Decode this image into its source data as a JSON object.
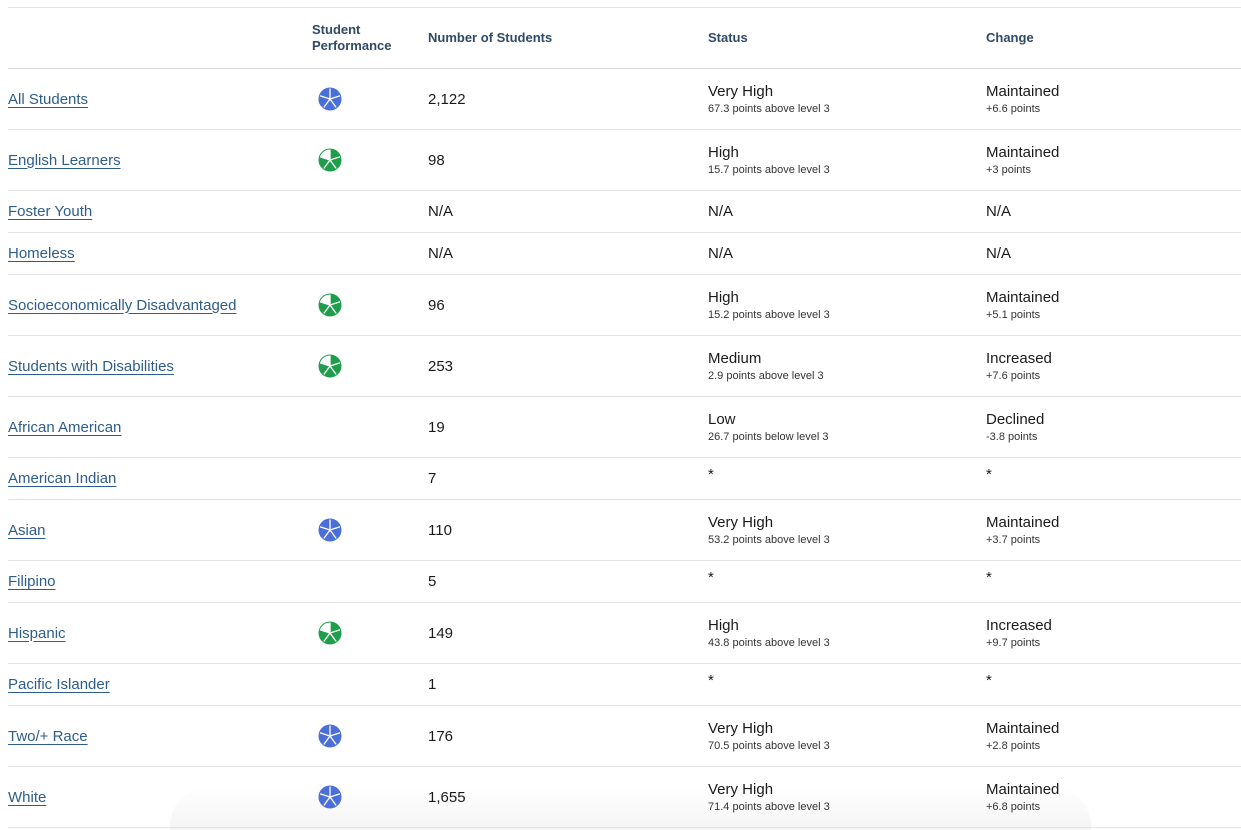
{
  "headers": {
    "group": "",
    "performance_line1": "Student",
    "performance_line2": "Performance",
    "count": "Number of Students",
    "status": "Status",
    "change": "Change"
  },
  "colors": {
    "blue": "#4a6fd8",
    "green": "#1e9e4a",
    "link": "#2e5d8a",
    "header": "#2f4a66"
  },
  "rows": [
    {
      "group": "All Students",
      "performance_icon": "blue",
      "count": "2,122",
      "status": "Very High",
      "status_detail": "67.3 points above level 3",
      "change": "Maintained",
      "change_detail": "+6.6 points"
    },
    {
      "group": "English Learners",
      "performance_icon": "green",
      "count": "98",
      "status": "High",
      "status_detail": "15.7 points above level 3",
      "change": "Maintained",
      "change_detail": "+3 points"
    },
    {
      "group": "Foster Youth",
      "performance_icon": "none",
      "count": "N/A",
      "status": "N/A",
      "status_detail": "",
      "change": "N/A",
      "change_detail": ""
    },
    {
      "group": "Homeless",
      "performance_icon": "none",
      "count": "N/A",
      "status": "N/A",
      "status_detail": "",
      "change": "N/A",
      "change_detail": ""
    },
    {
      "group": "Socioeconomically Disadvantaged",
      "performance_icon": "green",
      "count": "96",
      "status": "High",
      "status_detail": "15.2 points above level 3",
      "change": "Maintained",
      "change_detail": "+5.1 points"
    },
    {
      "group": "Students with Disabilities",
      "performance_icon": "green",
      "count": "253",
      "status": "Medium",
      "status_detail": "2.9 points above level 3",
      "change": "Increased",
      "change_detail": "+7.6 points"
    },
    {
      "group": "African American",
      "performance_icon": "none",
      "count": "19",
      "status": "Low",
      "status_detail": "26.7 points below level 3",
      "change": "Declined",
      "change_detail": "-3.8 points"
    },
    {
      "group": "American Indian",
      "performance_icon": "none",
      "count": "7",
      "status": "*",
      "status_detail": "",
      "change": "*",
      "change_detail": ""
    },
    {
      "group": "Asian",
      "performance_icon": "blue",
      "count": "110",
      "status": "Very High",
      "status_detail": "53.2 points above level 3",
      "change": "Maintained",
      "change_detail": "+3.7 points"
    },
    {
      "group": "Filipino",
      "performance_icon": "none",
      "count": "5",
      "status": "*",
      "status_detail": "",
      "change": "*",
      "change_detail": ""
    },
    {
      "group": "Hispanic",
      "performance_icon": "green",
      "count": "149",
      "status": "High",
      "status_detail": "43.8 points above level 3",
      "change": "Increased",
      "change_detail": "+9.7 points"
    },
    {
      "group": "Pacific Islander",
      "performance_icon": "none",
      "count": "1",
      "status": "*",
      "status_detail": "",
      "change": "*",
      "change_detail": ""
    },
    {
      "group": "Two/+ Race",
      "performance_icon": "blue",
      "count": "176",
      "status": "Very High",
      "status_detail": "70.5 points above level 3",
      "change": "Maintained",
      "change_detail": "+2.8 points"
    },
    {
      "group": "White",
      "performance_icon": "blue",
      "count": "1,655",
      "status": "Very High",
      "status_detail": "71.4 points above level 3",
      "change": "Maintained",
      "change_detail": "+6.8 points"
    }
  ]
}
